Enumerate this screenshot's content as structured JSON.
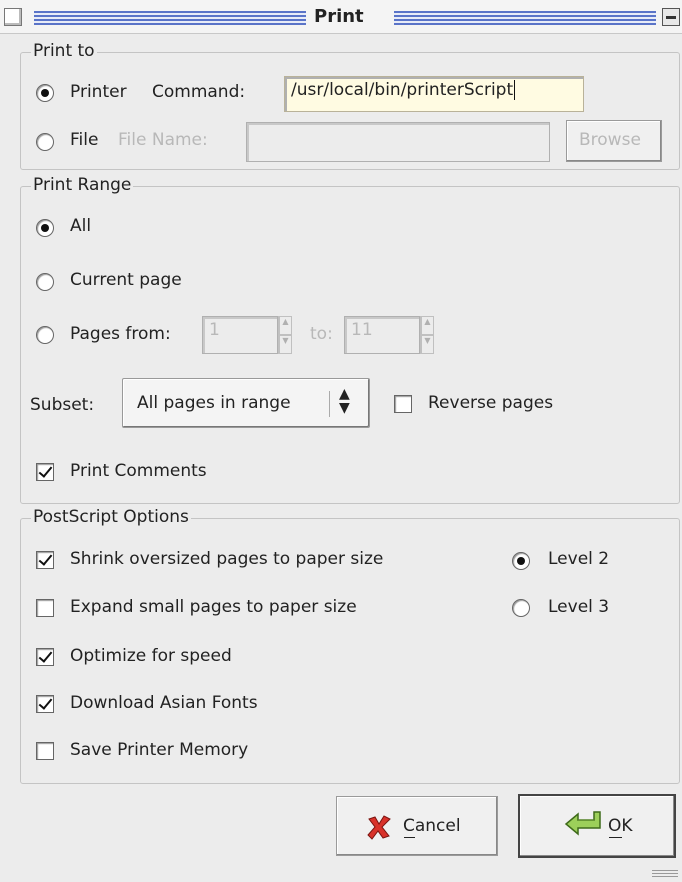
{
  "window": {
    "title": "Print"
  },
  "print_to": {
    "legend": "Print to",
    "printer_label": "Printer",
    "command_label": "Command:",
    "command_value": "/usr/local/bin/printerScript",
    "file_label": "File",
    "file_name_label": "File Name:",
    "file_name_value": "",
    "browse_label": "Browse",
    "selected": "printer"
  },
  "print_range": {
    "legend": "Print Range",
    "all_label": "All",
    "current_page_label": "Current page",
    "pages_from_label": "Pages from:",
    "from_value": "1",
    "to_label": "to:",
    "to_value": "11",
    "selected": "all",
    "subset_label": "Subset:",
    "subset_value": "All pages in range",
    "reverse_pages_label": "Reverse pages",
    "reverse_pages_checked": false,
    "print_comments_label": "Print Comments",
    "print_comments_checked": true
  },
  "postscript": {
    "legend": "PostScript Options",
    "shrink_label": "Shrink oversized pages to paper size",
    "shrink_checked": true,
    "expand_label": "Expand small pages to paper size",
    "expand_checked": false,
    "optimize_label": "Optimize for speed",
    "optimize_checked": true,
    "asian_fonts_label": "Download Asian Fonts",
    "asian_fonts_checked": true,
    "save_memory_label": "Save Printer Memory",
    "save_memory_checked": false,
    "level2_label": "Level 2",
    "level3_label": "Level 3",
    "selected_level": "Level 2"
  },
  "buttons": {
    "cancel_label": "Cancel",
    "ok_label": "OK"
  },
  "colors": {
    "title_stripes": "#5a74c8",
    "field_highlight": "#fffbe2",
    "cancel_x": "#d8322a",
    "ok_icon": "#5f8f2e"
  }
}
